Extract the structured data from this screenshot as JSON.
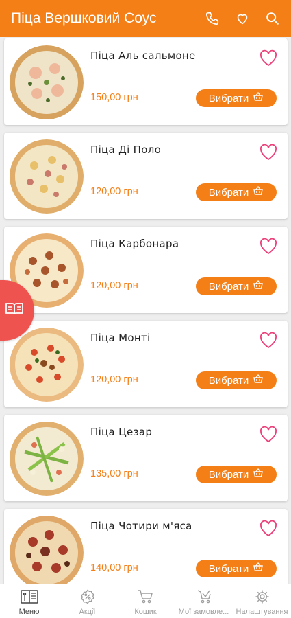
{
  "header": {
    "title": "Піца Вершковий Соус",
    "icons": [
      "phone-icon",
      "heart-icon",
      "search-icon"
    ]
  },
  "products": [
    {
      "name": "Піца Аль сальмоне",
      "price": "150,00 грн",
      "button": "Вибрати"
    },
    {
      "name": "Піца Ді Поло",
      "price": "120,00 грн",
      "button": "Вибрати"
    },
    {
      "name": "Піца Карбонара",
      "price": "120,00 грн",
      "button": "Вибрати"
    },
    {
      "name": "Піца Монті",
      "price": "120,00 грн",
      "button": "Вибрати"
    },
    {
      "name": "Піца Цезар",
      "price": "135,00 грн",
      "button": "Вибрати"
    },
    {
      "name": "Піца Чотири м'яса",
      "price": "140,00 грн",
      "button": "Вибрати"
    }
  ],
  "bottom_nav": [
    {
      "label": "Меню",
      "icon": "menu-book-icon",
      "active": true
    },
    {
      "label": "Акції",
      "icon": "percent-icon",
      "active": false
    },
    {
      "label": "Кошик",
      "icon": "cart-icon",
      "active": false
    },
    {
      "label": "Мої замовле...",
      "icon": "orders-icon",
      "active": false
    },
    {
      "label": "Налаштування",
      "icon": "gear-icon",
      "active": false
    }
  ],
  "colors": {
    "primary": "#f57f17",
    "side_tab": "#ef5350",
    "heart": "#ec407a"
  }
}
